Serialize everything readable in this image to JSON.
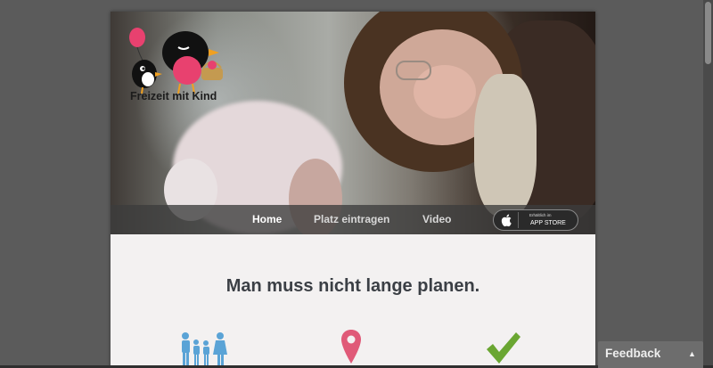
{
  "brand": {
    "name": "Freizeit mit Kind"
  },
  "nav": {
    "items": [
      {
        "label": "Home",
        "active": true
      },
      {
        "label": "Platz eintragen",
        "active": false
      },
      {
        "label": "Video",
        "active": false
      }
    ],
    "appstore": {
      "small_text": "Erhältlich im",
      "big_text": "APP STORE"
    }
  },
  "main": {
    "headline": "Man muss nicht lange planen."
  },
  "features": [
    {
      "icon": "family-icon",
      "color": "#5aa3d6"
    },
    {
      "icon": "location-pin-icon",
      "color": "#e05a78"
    },
    {
      "icon": "checkmark-icon",
      "color": "#6aa632"
    }
  ],
  "feedback": {
    "label": "Feedback"
  },
  "colors": {
    "nav_bg": "#3c3c3c",
    "page_bg": "#f3f1f1",
    "headline": "#3b3f45"
  }
}
